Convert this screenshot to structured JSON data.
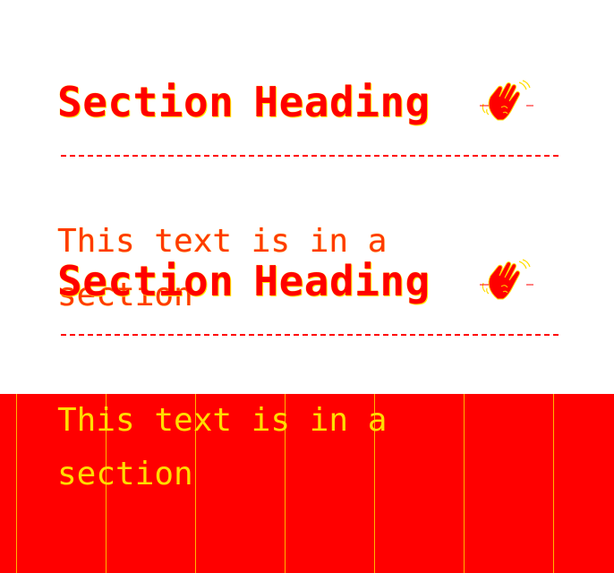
{
  "sections": [
    {
      "heading_first": "Section",
      "heading_second": "Heading",
      "icon": "waving-hand-icon",
      "body": "This text is in a section"
    },
    {
      "heading_first": "Section",
      "heading_second": "Heading",
      "icon": "waving-hand-icon",
      "body": "This text is in a section"
    }
  ],
  "colors": {
    "background": "#ffffff",
    "primary_red": "#ff0000",
    "accent_yellow": "#ffdd00"
  }
}
